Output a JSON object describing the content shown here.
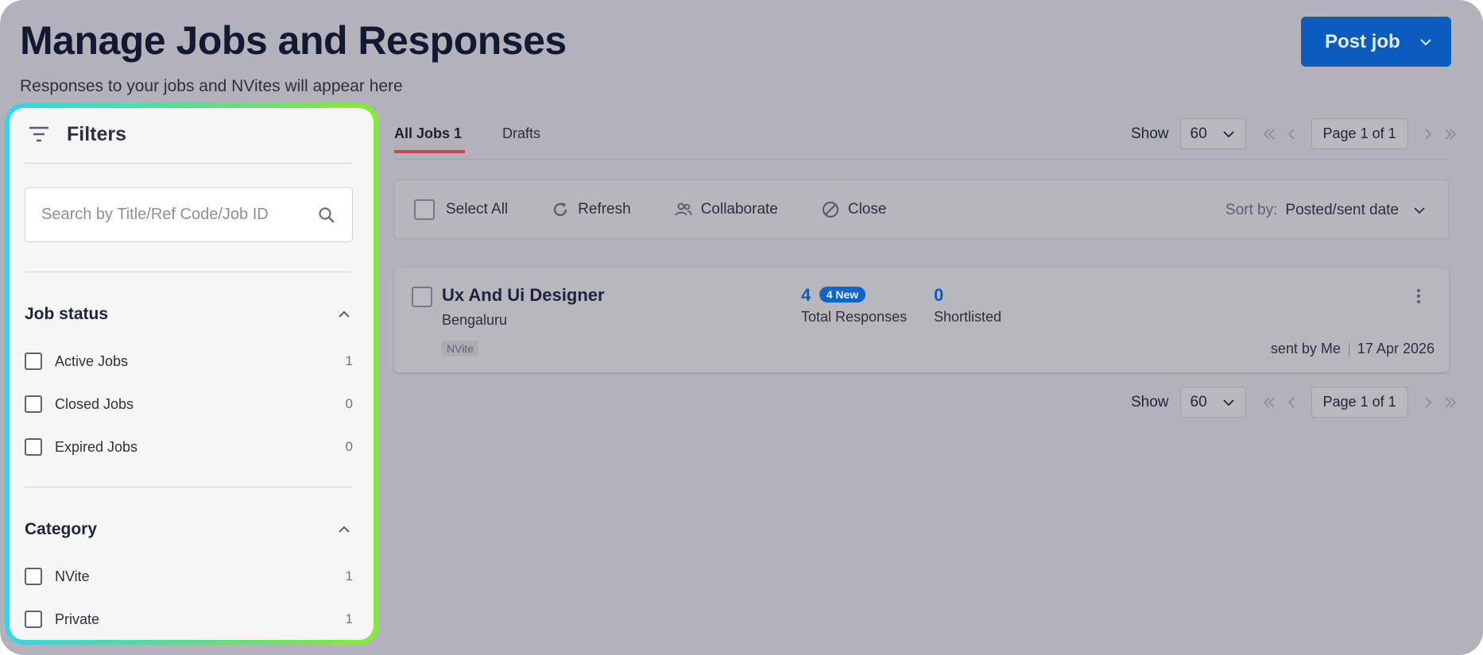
{
  "header": {
    "title": "Manage Jobs and Responses",
    "subtitle": "Responses to your jobs and NVites will appear here",
    "post_job_label": "Post job"
  },
  "filters": {
    "title": "Filters",
    "search_placeholder": "Search by Title/Ref Code/Job ID",
    "sections": [
      {
        "title": "Job status",
        "items": [
          {
            "label": "Active Jobs",
            "count": "1"
          },
          {
            "label": "Closed Jobs",
            "count": "0"
          },
          {
            "label": "Expired Jobs",
            "count": "0"
          }
        ]
      },
      {
        "title": "Category",
        "items": [
          {
            "label": "NVite",
            "count": "1"
          },
          {
            "label": "Private",
            "count": "1"
          }
        ]
      }
    ]
  },
  "tabs": [
    {
      "label": "All Jobs 1",
      "active": true
    },
    {
      "label": "Drafts",
      "active": false
    }
  ],
  "pagination": {
    "show_label": "Show",
    "per_page": "60",
    "page_label": "Page 1 of 1"
  },
  "toolbar": {
    "select_all": "Select All",
    "refresh": "Refresh",
    "collaborate": "Collaborate",
    "close": "Close",
    "sort_label": "Sort by:",
    "sort_value": "Posted/sent date"
  },
  "jobs": [
    {
      "title": "Ux And Ui Designer",
      "location": "Bengaluru",
      "tag": "NVite",
      "total_responses": "4",
      "new_badge": "4 New",
      "total_responses_label": "Total Responses",
      "shortlisted": "0",
      "shortlisted_label": "Shortlisted",
      "sent_by": "sent by Me",
      "date": "17 Apr 2026"
    }
  ],
  "colors": {
    "overlay": "#b3b2ba",
    "primary": "#0c5bbf",
    "active_tab": "#d2434f",
    "panel_gradient_start": "#2fd6ef",
    "panel_gradient_end": "#7cf12b"
  }
}
